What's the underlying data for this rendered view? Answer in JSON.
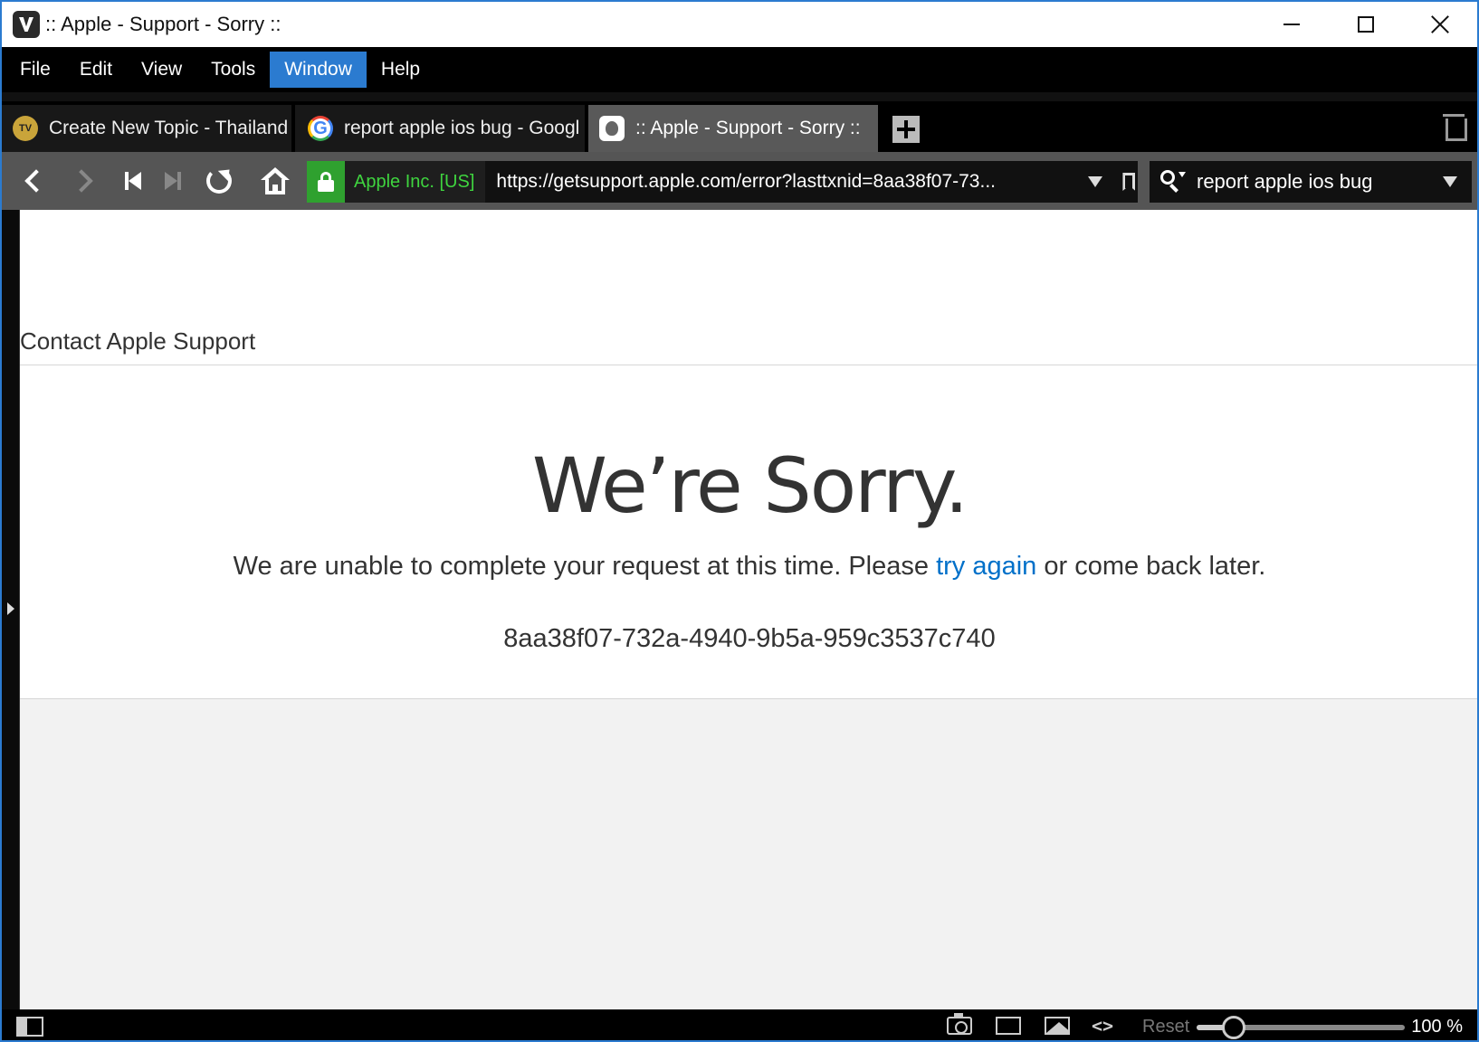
{
  "window": {
    "title": ":: Apple - Support - Sorry ::"
  },
  "menubar": {
    "items": [
      {
        "label": "File"
      },
      {
        "label": "Edit"
      },
      {
        "label": "View"
      },
      {
        "label": "Tools"
      },
      {
        "label": "Window",
        "active": true
      },
      {
        "label": "Help"
      }
    ]
  },
  "tabs": [
    {
      "label": "Create New Topic - Thailand",
      "icon": "thaivisa-favicon"
    },
    {
      "label": "report apple ios bug - Googl",
      "icon": "google-favicon"
    },
    {
      "label": ":: Apple - Support - Sorry ::",
      "icon": "apple-favicon",
      "active": true
    }
  ],
  "addressbar": {
    "security_label": "Apple Inc. [US]",
    "url": "https://getsupport.apple.com/error?lasttxnid=8aa38f07-73..."
  },
  "searchbar": {
    "value": "report apple ios bug"
  },
  "page": {
    "contact_heading": "Contact Apple Support",
    "title": "We’re Sorry.",
    "message_before": "We are unable to complete your request at this time. Please ",
    "message_link": "try again",
    "message_after": " or come back later.",
    "error_code": "8aa38f07-732a-4940-9b5a-959c3537c740"
  },
  "statusbar": {
    "reset_label": "Reset",
    "zoom_value": "100 %",
    "zoom_fraction": 0.18
  },
  "colors": {
    "accent": "#2b7bd0",
    "link": "#0070c9",
    "secure_green": "#2fa12f"
  }
}
